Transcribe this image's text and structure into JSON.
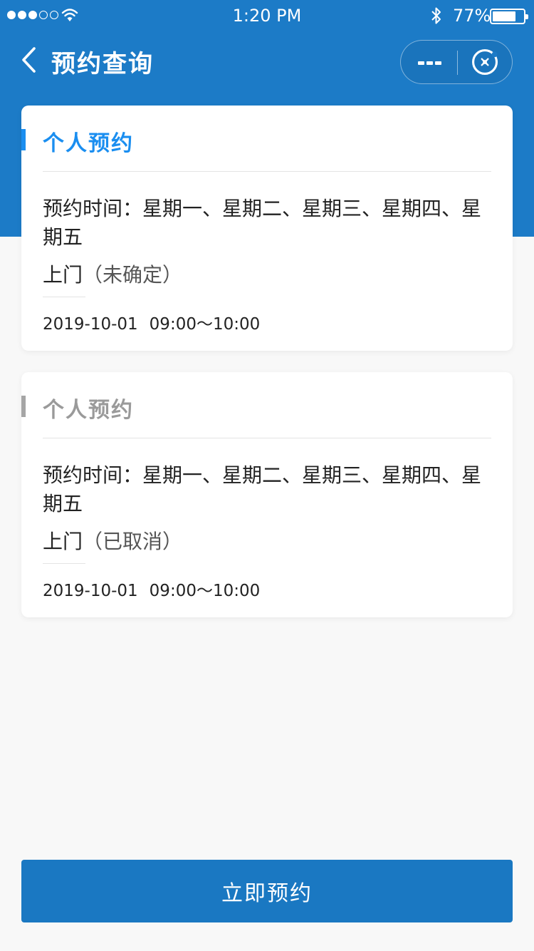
{
  "status_bar": {
    "time": "1:20 PM",
    "battery": "77%",
    "battery_level": 0.77
  },
  "nav": {
    "title": "预约查询"
  },
  "appointments": [
    {
      "title": "个人预约",
      "accent_color": "#1a8ef0",
      "time_label": "预约时间：",
      "days": "星期一、星期二、星期三、星期四、星期五",
      "type": "上门",
      "status": "（未确定）",
      "date": "2019-10-01",
      "time_range": "09:00～10:00"
    },
    {
      "title": "个人预约",
      "accent_color": "#a5a5a5",
      "time_label": "预约时间：",
      "days": "星期一、星期二、星期三、星期四、星期五",
      "type": "上门",
      "status": "（已取消）",
      "date": "2019-10-01",
      "time_range": "09:00～10:00"
    }
  ],
  "actions": {
    "book_now": "立即预约"
  },
  "colors": {
    "header_bg": "#1c7bc7",
    "button_bg": "#1a78c2",
    "page_bg": "#f8f8f8"
  }
}
